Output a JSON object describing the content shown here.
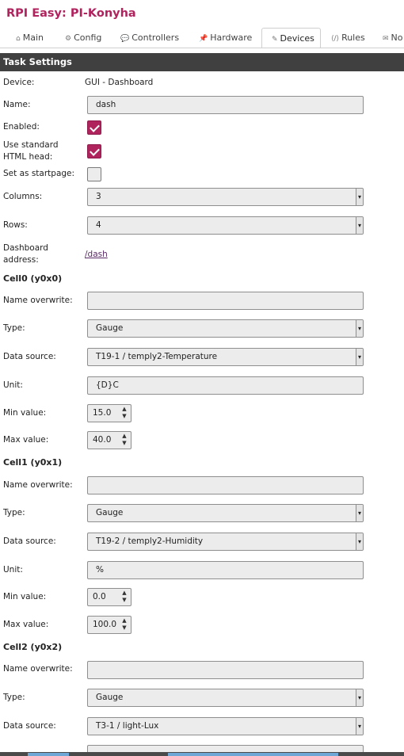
{
  "app": {
    "title": "RPI Easy: PI-Konyha"
  },
  "tabs": [
    {
      "label": "Main",
      "icon": "home-icon",
      "active": false
    },
    {
      "label": "Config",
      "icon": "gear-icon",
      "active": false
    },
    {
      "label": "Controllers",
      "icon": "chat-bubble-icon",
      "active": false
    },
    {
      "label": "Hardware",
      "icon": "pin-icon",
      "active": false
    },
    {
      "label": "Devices",
      "icon": "plug-icon",
      "active": true
    },
    {
      "label": "Rules",
      "icon": "code-icon",
      "active": false
    },
    {
      "label": "No",
      "icon": "bell-icon",
      "active": false
    }
  ],
  "section_title": "Task Settings",
  "form": {
    "device": {
      "label": "Device:",
      "value": "GUI - Dashboard"
    },
    "name": {
      "label": "Name:",
      "value": "dash"
    },
    "enabled": {
      "label": "Enabled:",
      "checked": true
    },
    "std_head": {
      "label": "Use standard HTML head:",
      "checked": true
    },
    "startpage": {
      "label": "Set as startpage:",
      "checked": false
    },
    "columns": {
      "label": "Columns:",
      "value": "3"
    },
    "rows": {
      "label": "Rows:",
      "value": "4"
    },
    "dash_addr": {
      "label": "Dashboard address:",
      "value": "/dash"
    }
  },
  "cells": [
    {
      "title": "Cell0 (y0x0)",
      "name_label": "Name overwrite:",
      "name_value": "",
      "type_label": "Type:",
      "type_value": "Gauge",
      "source_label": "Data source:",
      "source_value": "T19-1 / temply2-Temperature",
      "unit_label": "Unit:",
      "unit_value": "{D}C",
      "min_label": "Min value:",
      "min_value": "15.0",
      "max_label": "Max value:",
      "max_value": "40.0"
    },
    {
      "title": "Cell1 (y0x1)",
      "name_label": "Name overwrite:",
      "name_value": "",
      "type_label": "Type:",
      "type_value": "Gauge",
      "source_label": "Data source:",
      "source_value": "T19-2 / temply2-Humidity",
      "unit_label": "Unit:",
      "unit_value": "%",
      "min_label": "Min value:",
      "min_value": "0.0",
      "max_label": "Max value:",
      "max_value": "100.0"
    },
    {
      "title": "Cell2 (y0x2)",
      "name_label": "Name overwrite:",
      "name_value": "",
      "type_label": "Type:",
      "type_value": "Gauge",
      "source_label": "Data source:",
      "source_value": "T3-1 / light-Lux"
    }
  ],
  "colors": {
    "brand": "#b0245e",
    "header_bg": "#404040",
    "field_bg": "#ececec"
  }
}
